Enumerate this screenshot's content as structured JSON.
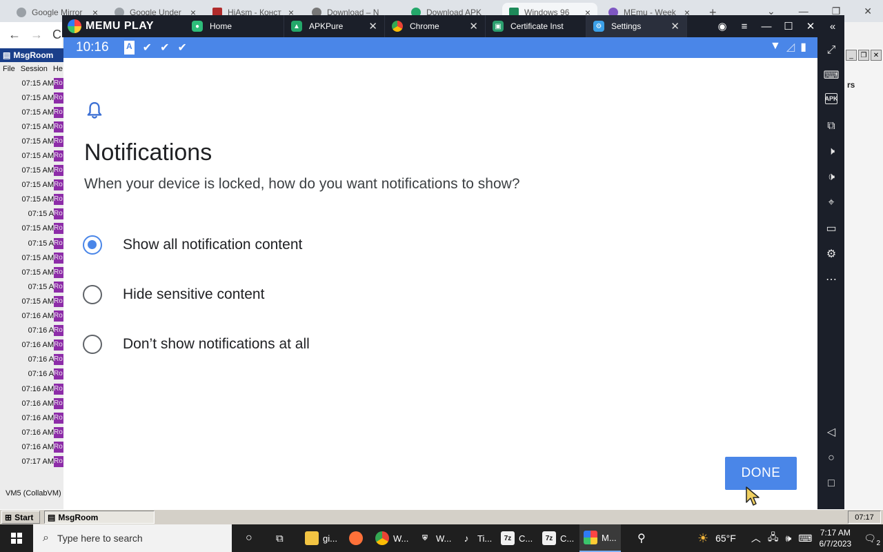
{
  "browser": {
    "tabs": [
      {
        "label": "Google Mirror"
      },
      {
        "label": "Google Under"
      },
      {
        "label": "HiAsm - Конст"
      },
      {
        "label": "Download – N"
      },
      {
        "label": "Download APK"
      },
      {
        "label": "Windows 96"
      },
      {
        "label": "MEmu - Week"
      }
    ],
    "new_tab": "+"
  },
  "msgroom": {
    "title": "MsgRoom",
    "menu": [
      "File",
      "Session",
      "He"
    ],
    "log_times": [
      "07:15 AM",
      "07:15 AM",
      "07:15 AM",
      "07:15 AM",
      "07:15 AM",
      "07:15 AM",
      "07:15 AM",
      "07:15 AM",
      "07:15 AM",
      "07:15 A",
      "07:15 AM",
      "07:15 A",
      "07:15 AM",
      "07:15 AM",
      "07:15 A",
      "07:15 AM",
      "07:16 AM",
      "07:16 A",
      "07:16 AM",
      "07:16 A",
      "07:16 A",
      "07:16 AM",
      "07:16 AM",
      "07:16 AM",
      "07:16 AM",
      "07:16 AM",
      "07:17 AM"
    ],
    "footer": "VM5 (CollabVM)",
    "right_header": "rs"
  },
  "memu": {
    "brand": "MEMU PLAY",
    "tabs": [
      {
        "label": "Home",
        "color": "#2ebd7a"
      },
      {
        "label": "APKPure",
        "color": "#24a86a"
      },
      {
        "label": "Chrome",
        "color": "#e0e0e0"
      },
      {
        "label": "Certificate Inst",
        "color": "#2b9e6e"
      },
      {
        "label": "Settings",
        "color": "#3ba0e8"
      }
    ],
    "collapse": "«"
  },
  "android": {
    "time": "10:16",
    "title": "Notifications",
    "subtitle": "When your device is locked, how do you want notifications to show?",
    "options": [
      {
        "label": "Show all notification content",
        "checked": true
      },
      {
        "label": "Hide sensitive content",
        "checked": false
      },
      {
        "label": "Don’t show notifications at all",
        "checked": false
      }
    ],
    "done_label": "DONE",
    "accent": "#4a86e8"
  },
  "sidebar_tools": [
    "fullscreen-icon",
    "keyboard-icon",
    "apk-icon",
    "multi-window-icon",
    "volume-up-icon",
    "volume-down-icon",
    "location-icon",
    "folder-icon",
    "settings-icon",
    "more-icon",
    "back-icon",
    "home-icon",
    "recents-icon"
  ],
  "msg_taskbar": {
    "start": "Start",
    "app": "MsgRoom",
    "clock": "07:17"
  },
  "taskbar": {
    "search_placeholder": "Type here to search",
    "apps": [
      {
        "label": "gi...",
        "color": "#f2c443"
      },
      {
        "label": "",
        "color": "#ff7139"
      },
      {
        "label": "W...",
        "color": "#4285f4"
      },
      {
        "label": "W...",
        "color": "#ffffff"
      },
      {
        "label": "Ti...",
        "color": "#111111"
      },
      {
        "label": "C...",
        "color": "#f0f0f0"
      },
      {
        "label": "C...",
        "color": "#f0f0f0"
      },
      {
        "label": "M...",
        "color": "#7e57c2"
      }
    ],
    "weather": "65°F",
    "time": "7:17 AM",
    "date": "6/7/2023",
    "notifications": "2"
  }
}
